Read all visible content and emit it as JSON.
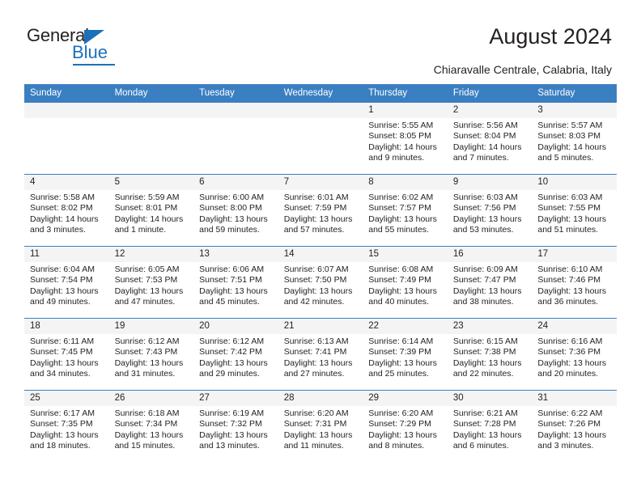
{
  "brand": {
    "name_part1": "General",
    "name_part2": "Blue"
  },
  "header": {
    "title": "August 2024",
    "subtitle": "Chiaravalle Centrale, Calabria, Italy"
  },
  "calendar": {
    "weekday_headers": [
      "Sunday",
      "Monday",
      "Tuesday",
      "Wednesday",
      "Thursday",
      "Friday",
      "Saturday"
    ],
    "header_bg": "#3a7fc1",
    "daynum_bg": "#f4f4f4",
    "weeks": [
      [
        {
          "day": "",
          "empty": true
        },
        {
          "day": "",
          "empty": true
        },
        {
          "day": "",
          "empty": true
        },
        {
          "day": "",
          "empty": true
        },
        {
          "day": "1",
          "sunrise": "Sunrise: 5:55 AM",
          "sunset": "Sunset: 8:05 PM",
          "daylight": "Daylight: 14 hours and 9 minutes."
        },
        {
          "day": "2",
          "sunrise": "Sunrise: 5:56 AM",
          "sunset": "Sunset: 8:04 PM",
          "daylight": "Daylight: 14 hours and 7 minutes."
        },
        {
          "day": "3",
          "sunrise": "Sunrise: 5:57 AM",
          "sunset": "Sunset: 8:03 PM",
          "daylight": "Daylight: 14 hours and 5 minutes."
        }
      ],
      [
        {
          "day": "4",
          "sunrise": "Sunrise: 5:58 AM",
          "sunset": "Sunset: 8:02 PM",
          "daylight": "Daylight: 14 hours and 3 minutes."
        },
        {
          "day": "5",
          "sunrise": "Sunrise: 5:59 AM",
          "sunset": "Sunset: 8:01 PM",
          "daylight": "Daylight: 14 hours and 1 minute."
        },
        {
          "day": "6",
          "sunrise": "Sunrise: 6:00 AM",
          "sunset": "Sunset: 8:00 PM",
          "daylight": "Daylight: 13 hours and 59 minutes."
        },
        {
          "day": "7",
          "sunrise": "Sunrise: 6:01 AM",
          "sunset": "Sunset: 7:59 PM",
          "daylight": "Daylight: 13 hours and 57 minutes."
        },
        {
          "day": "8",
          "sunrise": "Sunrise: 6:02 AM",
          "sunset": "Sunset: 7:57 PM",
          "daylight": "Daylight: 13 hours and 55 minutes."
        },
        {
          "day": "9",
          "sunrise": "Sunrise: 6:03 AM",
          "sunset": "Sunset: 7:56 PM",
          "daylight": "Daylight: 13 hours and 53 minutes."
        },
        {
          "day": "10",
          "sunrise": "Sunrise: 6:03 AM",
          "sunset": "Sunset: 7:55 PM",
          "daylight": "Daylight: 13 hours and 51 minutes."
        }
      ],
      [
        {
          "day": "11",
          "sunrise": "Sunrise: 6:04 AM",
          "sunset": "Sunset: 7:54 PM",
          "daylight": "Daylight: 13 hours and 49 minutes."
        },
        {
          "day": "12",
          "sunrise": "Sunrise: 6:05 AM",
          "sunset": "Sunset: 7:53 PM",
          "daylight": "Daylight: 13 hours and 47 minutes."
        },
        {
          "day": "13",
          "sunrise": "Sunrise: 6:06 AM",
          "sunset": "Sunset: 7:51 PM",
          "daylight": "Daylight: 13 hours and 45 minutes."
        },
        {
          "day": "14",
          "sunrise": "Sunrise: 6:07 AM",
          "sunset": "Sunset: 7:50 PM",
          "daylight": "Daylight: 13 hours and 42 minutes."
        },
        {
          "day": "15",
          "sunrise": "Sunrise: 6:08 AM",
          "sunset": "Sunset: 7:49 PM",
          "daylight": "Daylight: 13 hours and 40 minutes."
        },
        {
          "day": "16",
          "sunrise": "Sunrise: 6:09 AM",
          "sunset": "Sunset: 7:47 PM",
          "daylight": "Daylight: 13 hours and 38 minutes."
        },
        {
          "day": "17",
          "sunrise": "Sunrise: 6:10 AM",
          "sunset": "Sunset: 7:46 PM",
          "daylight": "Daylight: 13 hours and 36 minutes."
        }
      ],
      [
        {
          "day": "18",
          "sunrise": "Sunrise: 6:11 AM",
          "sunset": "Sunset: 7:45 PM",
          "daylight": "Daylight: 13 hours and 34 minutes."
        },
        {
          "day": "19",
          "sunrise": "Sunrise: 6:12 AM",
          "sunset": "Sunset: 7:43 PM",
          "daylight": "Daylight: 13 hours and 31 minutes."
        },
        {
          "day": "20",
          "sunrise": "Sunrise: 6:12 AM",
          "sunset": "Sunset: 7:42 PM",
          "daylight": "Daylight: 13 hours and 29 minutes."
        },
        {
          "day": "21",
          "sunrise": "Sunrise: 6:13 AM",
          "sunset": "Sunset: 7:41 PM",
          "daylight": "Daylight: 13 hours and 27 minutes."
        },
        {
          "day": "22",
          "sunrise": "Sunrise: 6:14 AM",
          "sunset": "Sunset: 7:39 PM",
          "daylight": "Daylight: 13 hours and 25 minutes."
        },
        {
          "day": "23",
          "sunrise": "Sunrise: 6:15 AM",
          "sunset": "Sunset: 7:38 PM",
          "daylight": "Daylight: 13 hours and 22 minutes."
        },
        {
          "day": "24",
          "sunrise": "Sunrise: 6:16 AM",
          "sunset": "Sunset: 7:36 PM",
          "daylight": "Daylight: 13 hours and 20 minutes."
        }
      ],
      [
        {
          "day": "25",
          "sunrise": "Sunrise: 6:17 AM",
          "sunset": "Sunset: 7:35 PM",
          "daylight": "Daylight: 13 hours and 18 minutes."
        },
        {
          "day": "26",
          "sunrise": "Sunrise: 6:18 AM",
          "sunset": "Sunset: 7:34 PM",
          "daylight": "Daylight: 13 hours and 15 minutes."
        },
        {
          "day": "27",
          "sunrise": "Sunrise: 6:19 AM",
          "sunset": "Sunset: 7:32 PM",
          "daylight": "Daylight: 13 hours and 13 minutes."
        },
        {
          "day": "28",
          "sunrise": "Sunrise: 6:20 AM",
          "sunset": "Sunset: 7:31 PM",
          "daylight": "Daylight: 13 hours and 11 minutes."
        },
        {
          "day": "29",
          "sunrise": "Sunrise: 6:20 AM",
          "sunset": "Sunset: 7:29 PM",
          "daylight": "Daylight: 13 hours and 8 minutes."
        },
        {
          "day": "30",
          "sunrise": "Sunrise: 6:21 AM",
          "sunset": "Sunset: 7:28 PM",
          "daylight": "Daylight: 13 hours and 6 minutes."
        },
        {
          "day": "31",
          "sunrise": "Sunrise: 6:22 AM",
          "sunset": "Sunset: 7:26 PM",
          "daylight": "Daylight: 13 hours and 3 minutes."
        }
      ]
    ]
  }
}
